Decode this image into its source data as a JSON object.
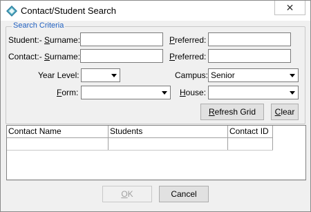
{
  "window": {
    "title": "Contact/Student Search",
    "close_glyph": "✕"
  },
  "group": {
    "legend": "Search Criteria"
  },
  "student_row": {
    "prefix": "Student:-",
    "surname_label": "Surname:",
    "surname_value": "",
    "preferred_label": "Preferred:",
    "preferred_value": ""
  },
  "contact_row": {
    "prefix": "Contact:-",
    "surname_label": "Surname:",
    "surname_value": "",
    "preferred_label": "Preferred:",
    "preferred_value": ""
  },
  "filters": {
    "year_level_label": "Year Level:",
    "year_level_value": "",
    "campus_label": "Campus:",
    "campus_value": "Senior",
    "form_label": "Form:",
    "form_value": "",
    "house_label": "House:",
    "house_value": ""
  },
  "buttons": {
    "refresh": "Refresh Grid",
    "clear": "Clear",
    "ok": "OK",
    "cancel": "Cancel"
  },
  "grid": {
    "columns": [
      "Contact Name",
      "Students",
      "Contact ID"
    ],
    "rows": [
      [
        "",
        "",
        ""
      ]
    ]
  },
  "colors": {
    "accent": "#0078d7",
    "legend": "#1f5fbf"
  },
  "icons": {
    "app": "diamond-app-icon",
    "dropdown": "chevron-down-icon",
    "close": "close-icon"
  }
}
